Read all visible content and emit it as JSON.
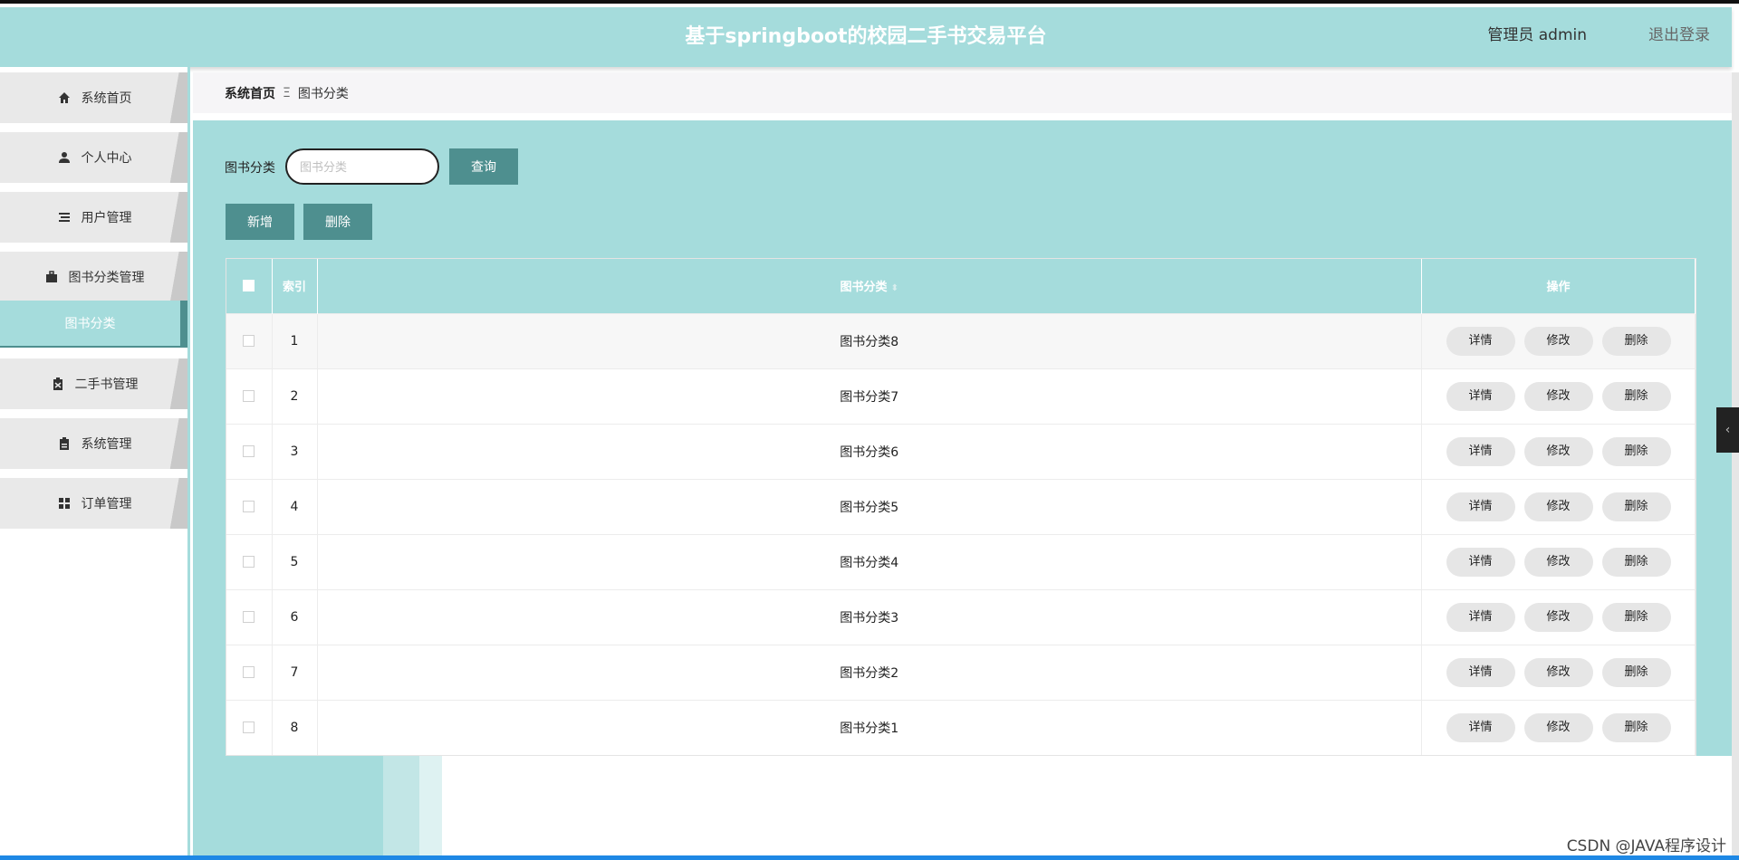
{
  "header": {
    "title": "基于springboot的校园二手书交易平台",
    "user_label": "管理员 admin",
    "logout_label": "退出登录"
  },
  "sidebar": {
    "items": [
      {
        "label": "系统首页",
        "icon": "home-icon"
      },
      {
        "label": "个人中心",
        "icon": "user-icon"
      },
      {
        "label": "用户管理",
        "icon": "list-icon"
      },
      {
        "label": "图书分类管理",
        "icon": "briefcase-icon"
      },
      {
        "label": "二手书管理",
        "icon": "clipboard-icon"
      },
      {
        "label": "系统管理",
        "icon": "clipboard-icon"
      },
      {
        "label": "订单管理",
        "icon": "grid-icon"
      }
    ],
    "active_sub": "图书分类"
  },
  "breadcrumb": {
    "home": "系统首页",
    "separator": "Ξ",
    "current": "图书分类"
  },
  "search": {
    "label": "图书分类",
    "placeholder": "图书分类",
    "query_button": "查询"
  },
  "actions": {
    "add": "新增",
    "delete": "删除"
  },
  "table": {
    "headers": {
      "index": "索引",
      "category": "图书分类",
      "operations": "操作"
    },
    "row_buttons": {
      "detail": "详情",
      "edit": "修改",
      "delete": "删除"
    },
    "rows": [
      {
        "index": "1",
        "category": "图书分类8"
      },
      {
        "index": "2",
        "category": "图书分类7"
      },
      {
        "index": "3",
        "category": "图书分类6"
      },
      {
        "index": "4",
        "category": "图书分类5"
      },
      {
        "index": "5",
        "category": "图书分类4"
      },
      {
        "index": "6",
        "category": "图书分类3"
      },
      {
        "index": "7",
        "category": "图书分类2"
      },
      {
        "index": "8",
        "category": "图书分类1"
      }
    ]
  },
  "watermark": "CSDN @JAVA程序设计",
  "colors": {
    "accent": "#a5dcdc",
    "button": "#4e8f8f"
  }
}
